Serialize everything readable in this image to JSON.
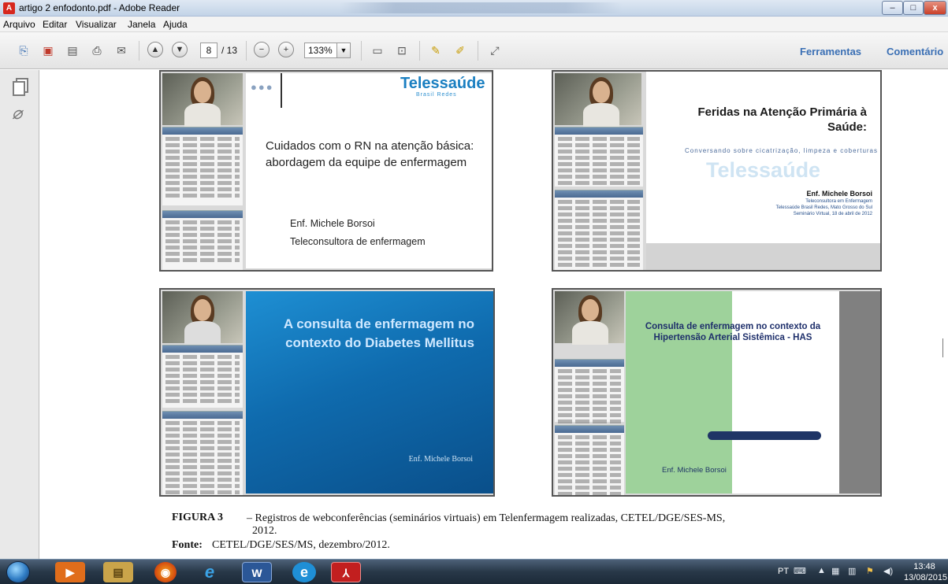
{
  "window": {
    "title": "artigo 2 enfodonto.pdf - Adobe Reader",
    "app_icon_letter": "A",
    "min_label": "–",
    "max_label": "□",
    "close_label": "x"
  },
  "menu": [
    "Arquivo",
    "Editar",
    "Visualizar",
    "Janela",
    "Ajuda"
  ],
  "toolbar": {
    "page_current": "8",
    "page_total": "/ 13",
    "zoom": "133%",
    "tools_label": "Ferramentas",
    "comment_label": "Comentário"
  },
  "slides": {
    "s1": {
      "dots": "●●●",
      "logo": "Telessaúde",
      "logo_sub": "Brasil Redes",
      "title": "Cuidados com o RN na atenção básica: abordagem da equipe de enfermagem",
      "author": "Enf. Michele Borsoi",
      "role": "Teleconsultora de enfermagem"
    },
    "s2": {
      "title": "Feridas na Atenção Primária à Saúde:",
      "subtitle": "Conversando sobre cicatrização, limpeza e coberturas",
      "watermark": "Telessaúde",
      "author": "Enf. Michele Borsoi",
      "detail1": "Teleconsultora em Enfermagem",
      "detail2": "Telessaúde Brasil Redes, Mato Grosso do Sul",
      "detail3": "Seminário Virtual, 18 de abril de 2012"
    },
    "s3": {
      "title": "A consulta de enfermagem no contexto do Diabetes Mellitus",
      "author": "Enf. Michele Borsoi"
    },
    "s4": {
      "title": "Consulta de enfermagem no contexto da Hipertensão Arterial Sistêmica - HAS",
      "author": "Enf. Michele Borsoi"
    }
  },
  "caption": {
    "label": "FIGURA 3",
    "text": "– Registros de webconferências (seminários virtuais) em Telenfermagem realizadas, CETEL/DGE/SES-MS,",
    "year": "2012.",
    "source_label": "Fonte:",
    "source_text": "CETEL/DGE/SES/MS, dezembro/2012."
  },
  "taskbar": {
    "apps": [
      "media-player",
      "file-explorer",
      "firefox",
      "internet-explorer",
      "word",
      "ie-edge",
      "adobe-reader"
    ],
    "app_glyphs": [
      "▶",
      "▤",
      "◉",
      "e",
      "W",
      "e",
      "⅄"
    ],
    "lang": "PT",
    "time": "13:48",
    "date": "13/08/2015"
  }
}
